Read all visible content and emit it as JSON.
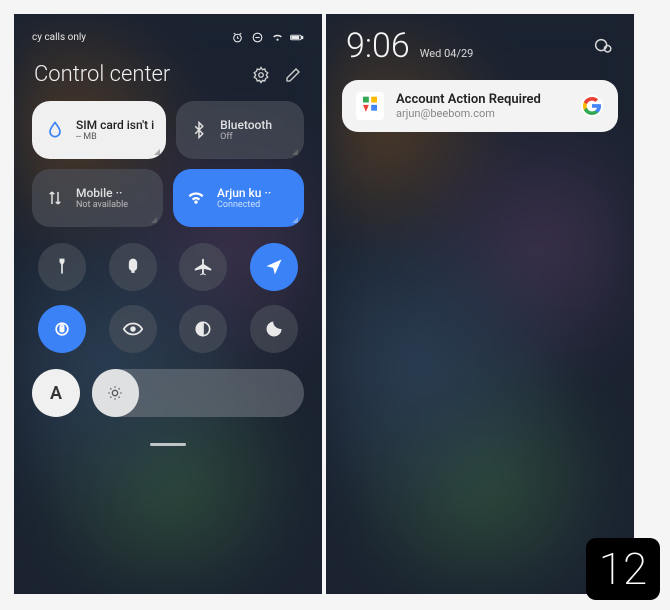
{
  "left": {
    "status_left": "cy calls only",
    "header": {
      "title": "Control center"
    },
    "tiles": {
      "sim": {
        "label": "SIM card isn't i",
        "sub": "-- MB"
      },
      "bluetooth": {
        "label": "Bluetooth",
        "sub": "Off"
      },
      "mobile": {
        "label": "Mobile ··",
        "sub": "Not available"
      },
      "wifi": {
        "label": "Arjun ku ··",
        "sub": "Connected"
      }
    },
    "auto_label": "A"
  },
  "right": {
    "time": "9:06",
    "date": "Wed 04/29",
    "notification": {
      "title": "Account Action Required",
      "sub": "arjun@beebom.com"
    }
  },
  "badge": "12"
}
